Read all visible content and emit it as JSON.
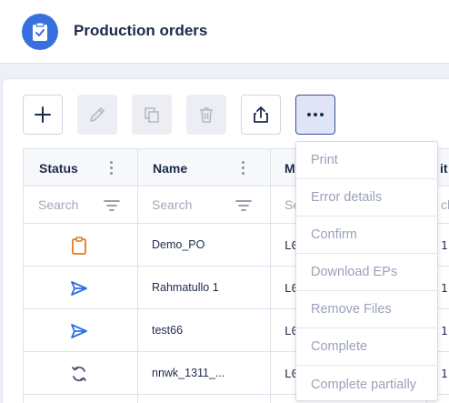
{
  "header": {
    "title": "Production orders",
    "icon": "clipboard-check-icon"
  },
  "toolbar": {
    "add": {
      "icon": "plus-icon",
      "enabled": true
    },
    "edit": {
      "icon": "pencil-icon",
      "enabled": false
    },
    "copy": {
      "icon": "copy-icon",
      "enabled": false
    },
    "delete": {
      "icon": "trash-icon",
      "enabled": false
    },
    "export": {
      "icon": "share-icon",
      "enabled": true
    },
    "more": {
      "icon": "more-horizontal-icon",
      "enabled": true
    }
  },
  "grid": {
    "columns": [
      {
        "label": "Status",
        "search_placeholder": "Search"
      },
      {
        "label": "Name",
        "search_placeholder": "Search"
      },
      {
        "label": "M",
        "search_placeholder": "Se"
      },
      {
        "label": "it",
        "search_placeholder": "ch"
      }
    ],
    "rows": [
      {
        "status_icon": "clipboard-icon",
        "status_color": "#e07b1a",
        "name": "Demo_PO",
        "col3": "L0",
        "col4": "1"
      },
      {
        "status_icon": "send-icon",
        "status_color": "#2d6fe0",
        "name": "Rahmatullo 1",
        "col3": "L0",
        "col4": "1"
      },
      {
        "status_icon": "send-icon",
        "status_color": "#2d6fe0",
        "name": "test66",
        "col3": "L0",
        "col4": "1"
      },
      {
        "status_icon": "refresh-icon",
        "status_color": "#4a5568",
        "name": "nnwk_1311_...",
        "col3": "L0",
        "col4": "1"
      }
    ]
  },
  "more_menu": {
    "items": [
      "Print",
      "Error details",
      "Confirm",
      "Download EPs",
      "Remove Files",
      "Complete",
      "Complete partially"
    ]
  },
  "colors": {
    "brand": "#3a6fe0",
    "text": "#1c2a4a",
    "disabled_text": "#9aa2b8",
    "border": "#dde2ec"
  }
}
